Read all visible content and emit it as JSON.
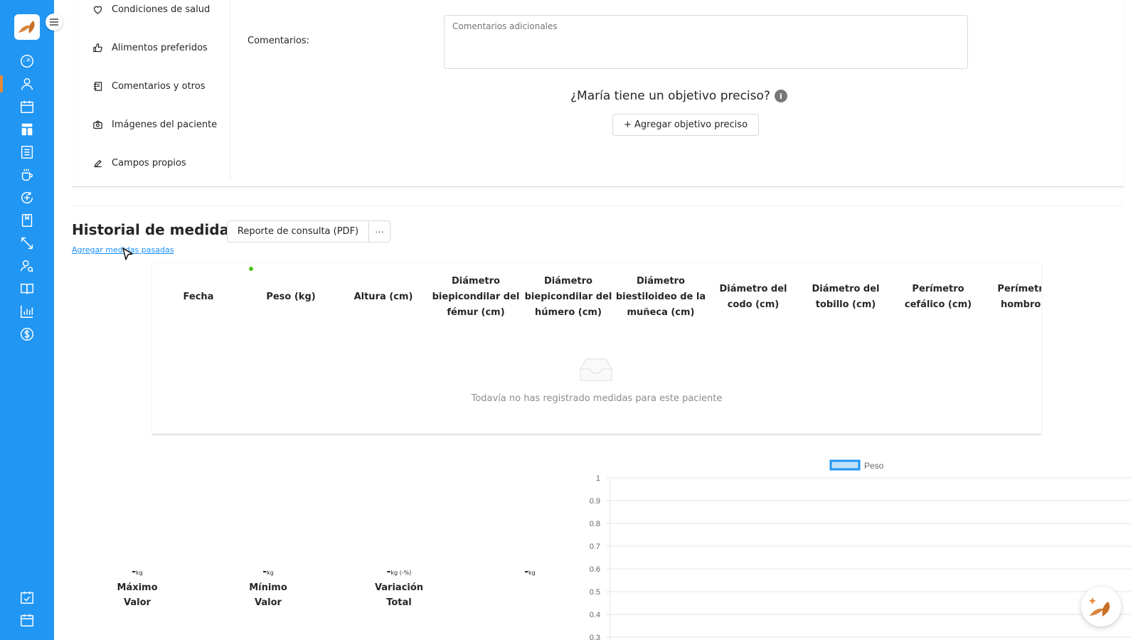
{
  "side_menu": {
    "items": [
      {
        "label": "Condiciones de salud",
        "icon": "heart-icon"
      },
      {
        "label": "Alimentos preferidos",
        "icon": "thumbs-up-icon"
      },
      {
        "label": "Comentarios y otros",
        "icon": "notes-icon"
      },
      {
        "label": "Imágenes del paciente",
        "icon": "camera-icon"
      },
      {
        "label": "Campos propios",
        "icon": "pencil-icon"
      }
    ]
  },
  "comments": {
    "label": "Comentarios:",
    "placeholder": "Comentarios adicionales"
  },
  "goal": {
    "question": "¿María tiene un objetivo preciso?",
    "button": "+ Agregar objetivo preciso"
  },
  "history": {
    "title": "Historial de medidas",
    "pdf_button": "Reporte de consulta (PDF)",
    "more_button": "···",
    "add_past_link": "Agregar medidas pasadas",
    "columns": [
      "Fecha",
      "Peso (kg)",
      "Altura (cm)",
      "Diámetro biepicondilar del fémur (cm)",
      "Diámetro biepicondilar del húmero (cm)",
      "Diámetro biestiloideo de la muñeca (cm)",
      "Diámetro del codo (cm)",
      "Diámetro del tobillo (cm)",
      "Perímetro cefálico (cm)",
      "Perímetro hombros"
    ],
    "empty_text": "Todavía no has registrado medidas para este paciente"
  },
  "stats": [
    {
      "value": "-",
      "unit": "kg",
      "label_1": "Máximo",
      "label_2": "Valor"
    },
    {
      "value": "-",
      "unit": "kg",
      "label_1": "Mínimo",
      "label_2": "Valor"
    },
    {
      "value": "-",
      "unit": "kg (-%)",
      "label_1": "Variación",
      "label_2": "Total"
    },
    {
      "value": "-",
      "unit": "kg",
      "label_1": "",
      "label_2": ""
    }
  ],
  "chart_data": {
    "type": "line",
    "series": [
      {
        "name": "Peso",
        "values": []
      }
    ],
    "y_ticks": [
      "1",
      "0.9",
      "0.8",
      "0.7",
      "0.6",
      "0.5",
      "0.4",
      "0.3"
    ],
    "ylim": [
      0.3,
      1
    ],
    "grid": true,
    "legend": "top",
    "colors": {
      "series": "#2196f3",
      "series_fill": "#bfe1fb"
    }
  },
  "colors": {
    "sidebar": "#2196f3",
    "accent": "#e8893a",
    "link": "#1890ff"
  }
}
